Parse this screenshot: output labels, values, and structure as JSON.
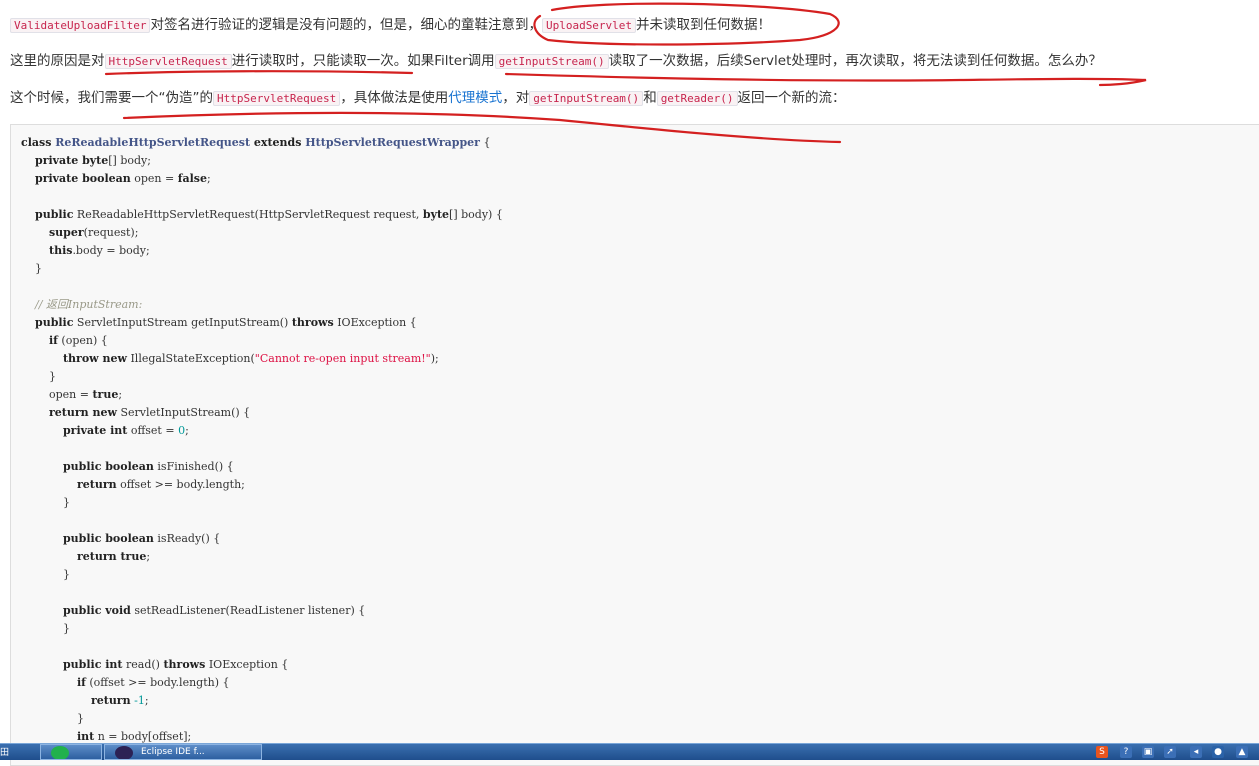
{
  "paragraphs": {
    "p1": {
      "code1": "ValidateUploadFilter",
      "text1": "对签名进行验证的逻辑是没有问题的，但是，细心的童鞋注意到，",
      "code2": "UploadServlet",
      "text2": "并未读取到任何数据！"
    },
    "p2": {
      "text1": "这里的原因是对",
      "code1": "HttpServletRequest",
      "text2": "进行读取时，只能读取一次。如果Filter调用",
      "code2": "getInputStream()",
      "text3": "读取了一次数据，后续Servlet处理时，再次读取，将无法读到任何数据。怎么办？"
    },
    "p3": {
      "text1": "这个时候，我们需要一个“伪造”的",
      "code1": "HttpServletRequest",
      "text2": "，具体做法是使用",
      "link": "代理模式",
      "text3": "，对",
      "code2": "getInputStream()",
      "text4": "和",
      "code3": "getReader()",
      "text5": "返回一个新的流："
    }
  },
  "code": {
    "l01a": "class ",
    "l01b": "ReReadableHttpServletRequest",
    "l01c": " extends ",
    "l01d": "HttpServletRequestWrapper",
    "l01e": " {",
    "l02a": "private byte",
    "l02b": "[] body;",
    "l03a": "private boolean",
    "l03b": " open = ",
    "l03c": "false",
    "l03d": ";",
    "l05a": "public",
    "l05b": " ReReadableHttpServletRequest(HttpServletRequest request, ",
    "l05c": "byte",
    "l05d": "[] body) {",
    "l06a": "super",
    "l06b": "(request);",
    "l07a": "this",
    "l07b": ".body = body;",
    "l08": "}",
    "l10": "// 返回InputStream:",
    "l11a": "public",
    "l11b": " ServletInputStream getInputStream() ",
    "l11c": "throws",
    "l11d": " IOException {",
    "l12a": "if",
    "l12b": " (open) {",
    "l13a": "throw new",
    "l13b": " IllegalStateException(",
    "l13c": "\"Cannot re-open input stream!\"",
    "l13d": ");",
    "l14": "}",
    "l15a": "open = ",
    "l15b": "true",
    "l15c": ";",
    "l16a": "return new",
    "l16b": " ServletInputStream() {",
    "l17a": "private int",
    "l17b": " offset = ",
    "l17c": "0",
    "l17d": ";",
    "l19a": "public boolean",
    "l19b": " isFinished() {",
    "l20a": "return",
    "l20b": " offset >= body.length;",
    "l21": "}",
    "l23a": "public boolean",
    "l23b": " isReady() {",
    "l24a": "return true",
    "l24b": ";",
    "l25": "}",
    "l27a": "public void",
    "l27b": " setReadListener(ReadListener listener) {",
    "l28": "}",
    "l30a": "public int",
    "l30b": " read() ",
    "l30c": "throws",
    "l30d": " IOException {",
    "l31a": "if",
    "l31b": " (offset >= body.length) {",
    "l32a": "return",
    "l32b": " -1",
    "l32c": ";",
    "l33": "}",
    "l34a": "int",
    "l34b": " n = body[offset];"
  },
  "taskbar": {
    "start_label": "田",
    "app2_label": "Eclipse IDE f..."
  },
  "colors": {
    "annotation_red": "#d42020",
    "inline_code_text": "#c7254e",
    "link": "#1a74d1"
  }
}
